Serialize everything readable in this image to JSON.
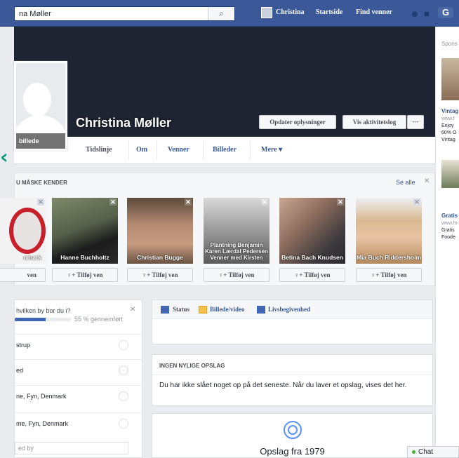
{
  "topbar": {
    "search_value": "na Møller",
    "nav": {
      "user": "Christina",
      "home": "Startside",
      "find_friends": "Find venner"
    }
  },
  "sidebar_ads": {
    "sponsored": "Spons",
    "ad1_title": "Vintag",
    "ad1_url": "www.f",
    "ad1_line1": "Enjoy",
    "ad1_line2": "60% O",
    "ad1_line3": "Vintag",
    "ad2_title": "Gratis",
    "ad2_url": "www.fo",
    "ad2_line1": "Gratis",
    "ad2_line2": "Foode"
  },
  "profile": {
    "name": "Christina Møller",
    "picture_label": "billede",
    "update_info_button": "Opdater oplysninger",
    "activity_log_button": "Vis aktivitetslog",
    "more_button": "···"
  },
  "tabs": [
    "Tidslinje",
    "Om",
    "Venner",
    "Billeder",
    "Mere ▾"
  ],
  "pymk": {
    "title": "U MÅSKE KENDER",
    "see_all": "Se alle",
    "close": "✕",
    "cards": [
      {
        "name": "nmark",
        "button": "ven"
      },
      {
        "name": "Hanne Buchholtz",
        "button": "Tilføj ven"
      },
      {
        "name": "Christian Bugge",
        "button": "Tilføj ven"
      },
      {
        "name": "Plantning Benjamin Karen Lærdal Pedersen Venner med Kirsten",
        "button": "Tilføj ven"
      },
      {
        "name": "Betina Bach Knudsen",
        "button": "Tilføj ven"
      },
      {
        "name": "Mia Buch Riddersholm",
        "button": "Tilføj ven"
      }
    ]
  },
  "city_question": {
    "title": "hvilken by bor du i?",
    "close": "✕",
    "progress": 0.55,
    "progress_text": "55 % gennemført",
    "options": [
      "strup",
      "ed",
      "ne, Fyn, Denmark",
      "me, Fyn, Denmark"
    ],
    "other_placeholder": "ed by"
  },
  "composer": {
    "status": "Status",
    "photo_video": "Billede/video",
    "life_event": "Livsbegivenhed"
  },
  "no_posts": {
    "title": "INGEN NYLIGE OPSLAG",
    "text": "Du har ikke slået noget op på det seneste. Når du laver et opslag, vises det her."
  },
  "year_section": {
    "label": "Opslag fra 1979"
  },
  "chat": {
    "label": "Chat"
  },
  "colors": {
    "brand": "#3b5998",
    "link": "#365899",
    "accent_arrow": "#0a9b78"
  }
}
